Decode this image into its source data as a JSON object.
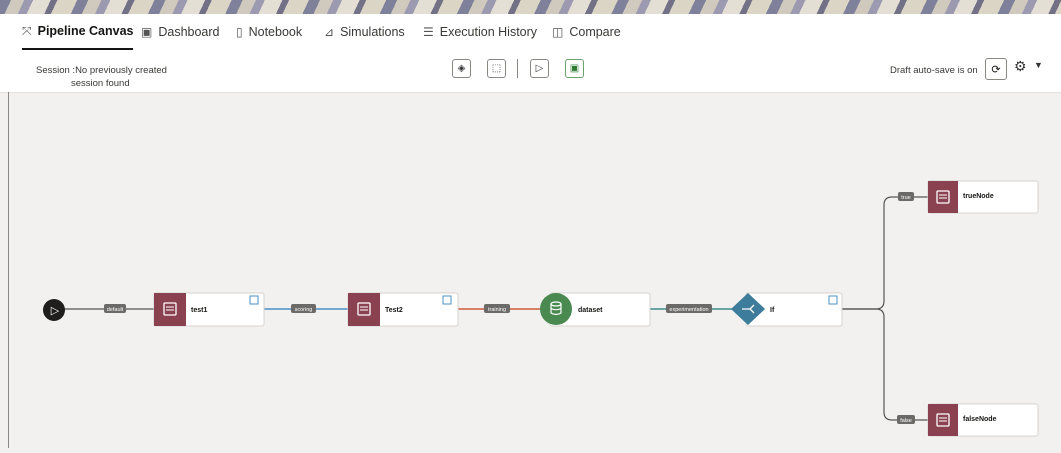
{
  "tabs": [
    {
      "label": "Pipeline Canvas",
      "icon": "pipeline-icon",
      "glyph": "⤧",
      "active": true
    },
    {
      "label": "Dashboard",
      "icon": "dashboard-icon",
      "glyph": "▣",
      "active": false
    },
    {
      "label": "Notebook",
      "icon": "notebook-icon",
      "glyph": "▯",
      "active": false
    },
    {
      "label": "Simulations",
      "icon": "simulations-icon",
      "glyph": "⊿",
      "active": false
    },
    {
      "label": "Execution History",
      "icon": "execution-history-icon",
      "glyph": "☰",
      "active": false
    },
    {
      "label": "Compare",
      "icon": "compare-icon",
      "glyph": "◫",
      "active": false
    }
  ],
  "toolbar": {
    "session_line1": "Session :No previously created",
    "session_line2": "session found",
    "autosave": "Draft auto-save is on",
    "buttons": [
      {
        "name": "clear-canvas-button",
        "icon": "eraser-icon",
        "glyph": "◈"
      },
      {
        "name": "select-node-button",
        "icon": "select-icon",
        "glyph": "⬚"
      },
      {
        "name": "run-button",
        "icon": "play-icon",
        "glyph": "▷"
      },
      {
        "name": "save-button",
        "icon": "save-icon",
        "glyph": "▣"
      }
    ]
  },
  "pipeline": {
    "start_glyph": "▷",
    "nodes": [
      {
        "id": "test1",
        "label": "test1",
        "kind": "notebook",
        "color": "#8b4250"
      },
      {
        "id": "test2",
        "label": "Test2",
        "kind": "notebook",
        "color": "#8b4250"
      },
      {
        "id": "dataset",
        "label": "dataset",
        "kind": "dataset",
        "color": "#4a8a50"
      },
      {
        "id": "if",
        "label": "If",
        "kind": "condition",
        "color": "#3d7c9a"
      },
      {
        "id": "trueNode",
        "label": "trueNode",
        "kind": "notebook",
        "color": "#8b4250"
      },
      {
        "id": "falseNode",
        "label": "falseNode",
        "kind": "notebook",
        "color": "#8b4250"
      }
    ],
    "edges": [
      {
        "label": "default",
        "color": "#666666"
      },
      {
        "label": "scoring",
        "color": "#4a8fc4"
      },
      {
        "label": "training",
        "color": "#d05a3a"
      },
      {
        "label": "experimentation",
        "color": "#3a8a8a"
      },
      {
        "label": "true",
        "color": "#555555"
      },
      {
        "label": "false",
        "color": "#555555"
      }
    ]
  }
}
